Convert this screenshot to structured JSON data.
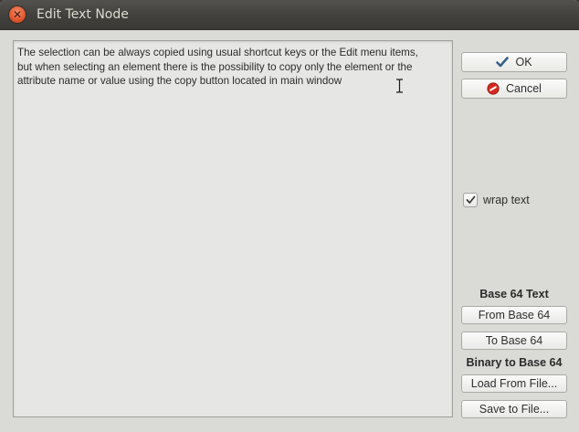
{
  "window": {
    "title": "Edit Text Node",
    "close_icon": "close-icon"
  },
  "editor": {
    "text": "The selection can be always copied using usual shortcut keys or the Edit menu items,\nbut when selecting an element there is the possibility to copy only the element or the\nattribute name or value using the copy button located in main window"
  },
  "buttons": {
    "ok": {
      "label": "OK",
      "icon": "check-icon"
    },
    "cancel": {
      "label": "Cancel",
      "icon": "cancel-icon"
    }
  },
  "options": {
    "wrap_text": {
      "label": "wrap text",
      "checked": true
    }
  },
  "base64": {
    "heading": "Base 64 Text",
    "from_label": "From Base 64",
    "to_label": "To Base 64"
  },
  "binary": {
    "heading": "Binary to Base 64",
    "load_label": "Load From File...",
    "save_label": "Save to File..."
  },
  "colors": {
    "title_bar": "#403f3b",
    "close_button": "#e25a32",
    "window_bg": "#dadad6",
    "cancel_icon": "#d42a1f",
    "ok_icon": "#3a5f8a"
  }
}
